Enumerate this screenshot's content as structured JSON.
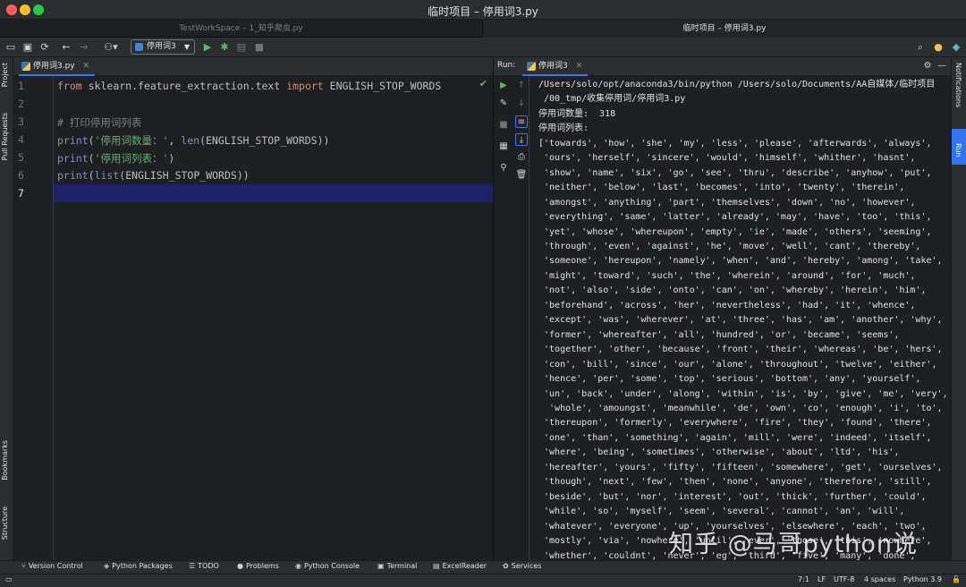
{
  "window": {
    "title": "临时项目 – 停用词3.py"
  },
  "workspace_tabs": [
    "TestWorkSpace – 1_知乎爬虫.py",
    "临时项目 – 停用词3.py"
  ],
  "toolbar": {
    "run_config": "停用词3"
  },
  "left_tools": [
    "Project",
    "Pull Requests",
    "Bookmarks",
    "Structure"
  ],
  "editor": {
    "tab_label": "停用词3.py",
    "line_numbers": [
      "1",
      "2",
      "3",
      "4",
      "5",
      "6",
      "7"
    ],
    "lines": [
      {
        "kw": "from",
        "plain": " sklearn.feature_extraction.text ",
        "kw2": "import",
        "plain2": " ENGLISH_STOP_WORDS"
      },
      {
        "comment": "# 打印停用词列表"
      },
      {
        "fn": "print",
        "open": "(",
        "str": "'停用词数量：'",
        "mid": ", ",
        "fn2": "len",
        "rest": "(ENGLISH_STOP_WORDS))"
      },
      {
        "fn": "print",
        "open": "(",
        "str": "'停用词列表：'",
        "rest": ")"
      },
      {
        "fn": "print",
        "open": "(",
        "fn2": "list",
        "rest": "(ENGLISH_STOP_WORDS))"
      }
    ]
  },
  "run": {
    "label": "Run:",
    "tab_label": "停用词3",
    "console_lines": [
      "/Users/solo/opt/anaconda3/bin/python /Users/solo/Documents/AA自媒体/临时项目",
      " /00_tmp/收集停用词/停用词3.py",
      "停用词数量:  318",
      "停用词列表:",
      "['towards', 'how', 'she', 'my', 'less', 'please', 'afterwards', 'always',",
      " 'ours', 'herself', 'sincere', 'would', 'himself', 'whither', 'hasnt',",
      " 'show', 'name', 'six', 'go', 'see', 'thru', 'describe', 'anyhow', 'put',",
      " 'neither', 'below', 'last', 'becomes', 'into', 'twenty', 'therein',",
      " 'amongst', 'anything', 'part', 'themselves', 'down', 'no', 'however',",
      " 'everything', 'same', 'latter', 'already', 'may', 'have', 'too', 'this',",
      " 'yet', 'whose', 'whereupon', 'empty', 'ie', 'made', 'others', 'seeming',",
      " 'through', 'even', 'against', 'he', 'move', 'well', 'cant', 'thereby',",
      " 'someone', 'hereupon', 'namely', 'when', 'and', 'hereby', 'among', 'take',",
      " 'might', 'toward', 'such', 'the', 'wherein', 'around', 'for', 'much',",
      " 'not', 'also', 'side', 'onto', 'can', 'on', 'whereby', 'herein', 'him',",
      " 'beforehand', 'across', 'her', 'nevertheless', 'had', 'it', 'whence',",
      " 'except', 'was', 'wherever', 'at', 'three', 'has', 'am', 'another', 'why',",
      " 'former', 'whereafter', 'all', 'hundred', 'or', 'became', 'seems',",
      " 'together', 'other', 'because', 'front', 'their', 'whereas', 'be', 'hers',",
      " 'con', 'bill', 'since', 'our', 'alone', 'throughout', 'twelve', 'either',",
      " 'hence', 'per', 'some', 'top', 'serious', 'bottom', 'any', 'yourself',",
      " 'un', 'back', 'under', 'along', 'within', 'is', 'by', 'give', 'me', 'very',",
      "  'whole', 'amoungst', 'meanwhile', 'de', 'own', 'co', 'enough', 'i', 'to',",
      " 'thereupon', 'formerly', 'everywhere', 'fire', 'they', 'found', 'there',",
      " 'one', 'than', 'something', 'again', 'mill', 'were', 'indeed', 'itself',",
      " 'where', 'being', 'sometimes', 'otherwise', 'about', 'ltd', 'his',",
      " 'hereafter', 'yours', 'fifty', 'fifteen', 'somewhere', 'get', 'ourselves',",
      " 'though', 'next', 'few', 'then', 'none', 'anyone', 'therefore', 'still',",
      " 'beside', 'but', 'nor', 'interest', 'out', 'thick', 'further', 'could',",
      " 'while', 'so', 'myself', 'seem', 'several', 'cannot', 'an', 'will',",
      " 'whatever', 'everyone', 'up', 'yourselves', 'elsewhere', 'each', 'two',",
      " 'mostly', 'via', 'nowhere', 'until', 'ever', 'those', 'this', 'nowhere',",
      " 'whether', 'couldnt', 'never', 'eg', 'third', 'five', 'many', 'done',"
    ]
  },
  "right_tools": [
    "Notifications",
    "Run"
  ],
  "bottom_tools": [
    "Version Control",
    "Python Packages",
    "TODO",
    "Problems",
    "Python Console",
    "Terminal",
    "ExcelReader",
    "Services"
  ],
  "status": {
    "position": "7:1",
    "line_sep": "LF",
    "encoding": "UTF-8",
    "indent": "4 spaces",
    "interpreter": "Python 3.9"
  },
  "watermark": "知乎 @马哥python说",
  "colors": {
    "accent": "#3574f0",
    "current_line": "#1c2064",
    "run_green": "#5fb865"
  }
}
